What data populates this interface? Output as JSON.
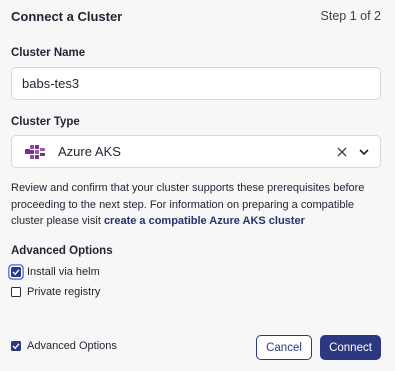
{
  "header": {
    "title": "Connect a Cluster",
    "step": "Step 1 of 2"
  },
  "cluster_name": {
    "label": "Cluster Name",
    "value": "babs-tes3"
  },
  "cluster_type": {
    "label": "Cluster Type",
    "selected": "Azure AKS",
    "icon": "azure-aks-icon"
  },
  "description": {
    "text": "Review and confirm that your cluster supports these prerequisites before proceeding to the next step. For information on preparing a compatible cluster please visit ",
    "link": "create a compatible Azure AKS cluster"
  },
  "advanced": {
    "label": "Advanced Options",
    "options": [
      {
        "label": "Install via helm",
        "checked": true
      },
      {
        "label": "Private registry",
        "checked": false
      }
    ]
  },
  "footer": {
    "advanced_toggle": {
      "label": "Advanced Options",
      "checked": true
    },
    "cancel_label": "Cancel",
    "connect_label": "Connect"
  },
  "colors": {
    "primary": "#2d3882",
    "link": "#27316d",
    "focus": "#3b6fd9",
    "background": "#f7f7f8"
  }
}
